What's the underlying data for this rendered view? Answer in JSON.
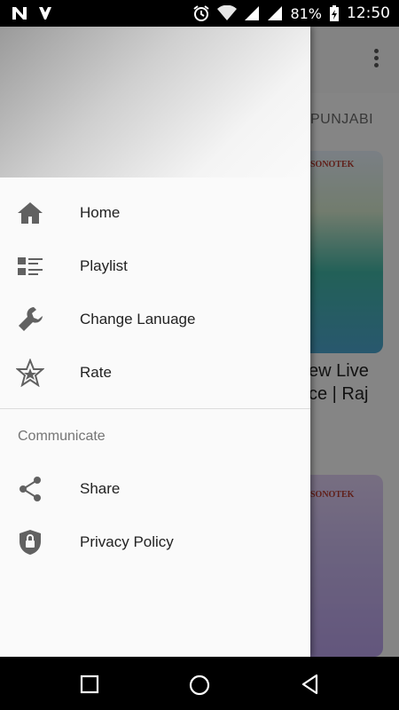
{
  "status_bar": {
    "battery": "81%",
    "time": "12:50"
  },
  "background_app": {
    "tab_label": "PUNJABI",
    "brand_label_1": "SONOTEK",
    "brand_label_2": "SONOTEK",
    "card_text_line1": "ew Live",
    "card_text_line2": "ce | Raj"
  },
  "drawer": {
    "items": [
      {
        "label": "Home",
        "icon": "home-icon"
      },
      {
        "label": "Playlist",
        "icon": "playlist-icon"
      },
      {
        "label": "Change Lanuage",
        "icon": "wrench-icon"
      },
      {
        "label": "Rate",
        "icon": "star-icon"
      }
    ],
    "section_title": "Communicate",
    "section_items": [
      {
        "label": "Share",
        "icon": "share-icon"
      },
      {
        "label": "Privacy Policy",
        "icon": "shield-lock-icon"
      }
    ]
  },
  "colors": {
    "icon_gray": "#616161",
    "text_dark": "#222222",
    "section_gray": "#757575"
  }
}
